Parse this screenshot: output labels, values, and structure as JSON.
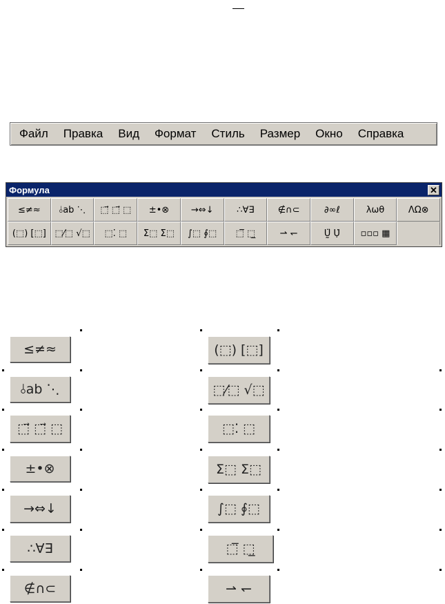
{
  "menubar": {
    "items": [
      "Файл",
      "Правка",
      "Вид",
      "Формат",
      "Стиль",
      "Размер",
      "Окно",
      "Справка"
    ]
  },
  "formula_toolbar": {
    "title": "Формула",
    "close_glyph": "✕",
    "row1": [
      "≤≠≈",
      "⫰ab ⋱",
      "⬚⃗ ⬚⃗ ⬚",
      "±•⊗",
      "→⇔↓",
      "∴∀∃",
      "∉∩⊂",
      "∂∞ℓ",
      "λωθ",
      "ΛΩ⊗"
    ],
    "row2": [
      "(⬚) [⬚]",
      "⬚⁄⬚ √⬚",
      "⬚⁚ ⬚",
      "Σ⬚ Σ⬚",
      "∫⬚ ∮⬚",
      "⬚̅ ⬚̲",
      "⇀ ↽",
      "Ṵ̈ Ụ̇",
      "▫▫▫ ▦",
      ""
    ]
  },
  "palette": {
    "left": [
      "≤≠≈",
      "⫰ab ⋱",
      "⬚⃗ ⬚⃗ ⬚",
      "±•⊗",
      "→⇔↓",
      "∴∀∃",
      "∉∩⊂"
    ],
    "right": [
      "(⬚) [⬚]",
      "⬚⁄⬚ √⬚",
      "⬚⁚ ⬚",
      "Σ⬚ Σ⬚",
      "∫⬚ ∮⬚",
      "⬚̅ ⬚̲",
      "⇀ ↽"
    ]
  }
}
